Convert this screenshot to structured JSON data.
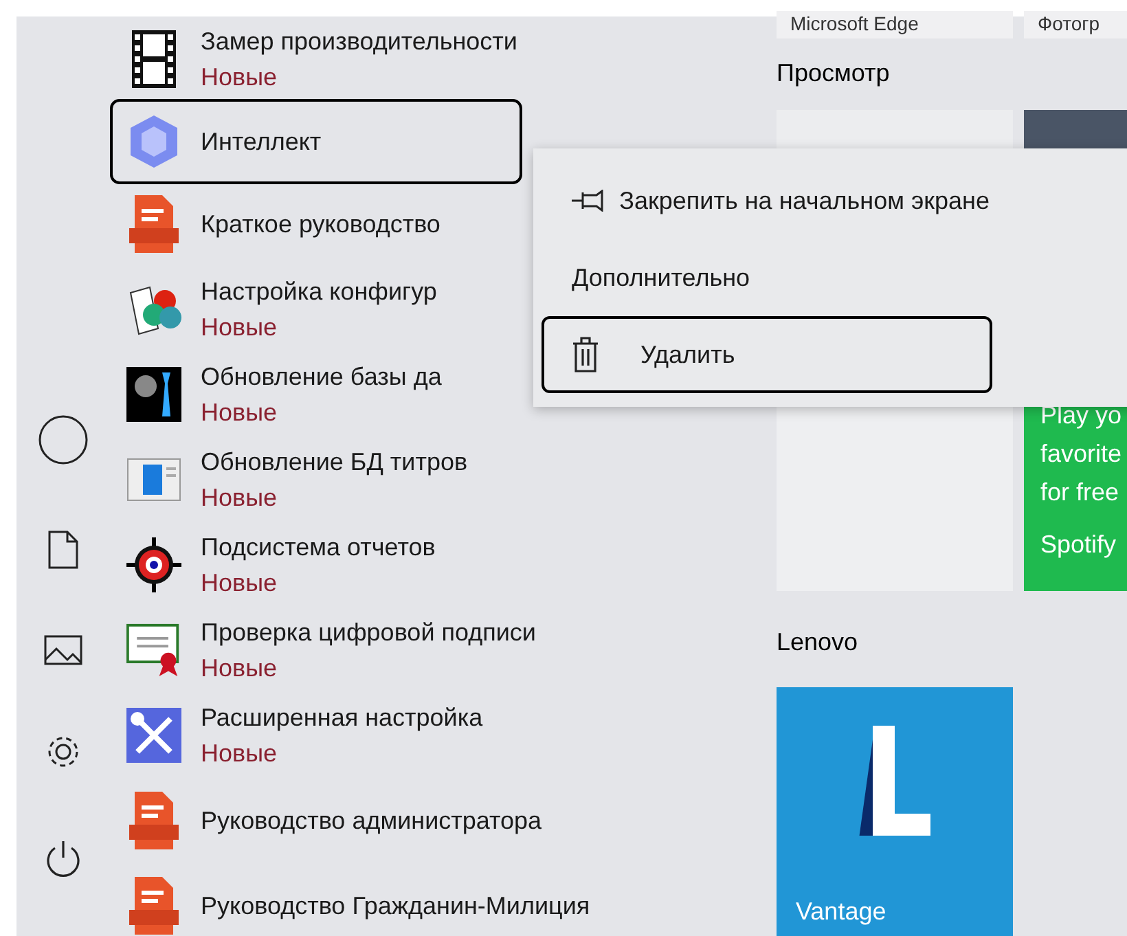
{
  "top_tiles": [
    {
      "label": "Microsoft Edge"
    },
    {
      "label": "Фотогр"
    }
  ],
  "apps": [
    {
      "name": "Замер производительности",
      "badge": "Новые",
      "selected": false
    },
    {
      "name": "Интеллект",
      "selected": true
    },
    {
      "name": "Краткое руководство",
      "selected": false
    },
    {
      "name": "Настройка конфигур",
      "badge": "Новые",
      "selected": false
    },
    {
      "name": "Обновление базы да",
      "badge": "Новые",
      "selected": false
    },
    {
      "name": "Обновление БД титров",
      "badge": "Новые",
      "selected": false
    },
    {
      "name": "Подсистема отчетов",
      "badge": "Новые",
      "selected": false
    },
    {
      "name": "Проверка цифровой подписи",
      "badge": "Новые",
      "selected": false
    },
    {
      "name": "Расширенная настройка",
      "badge": "Новые",
      "selected": false
    },
    {
      "name": "Руководство администратора",
      "selected": false
    },
    {
      "name": "Руководство Гражданин-Милиция",
      "selected": false
    }
  ],
  "groups": [
    {
      "title": "Просмотр"
    },
    {
      "title": "Lenovo"
    }
  ],
  "spotify_tile": {
    "lines": [
      "Play yo",
      "favorite",
      "for free"
    ],
    "label": "Spotify"
  },
  "vantage_tile": {
    "label": "Vantage"
  },
  "context_menu": [
    {
      "label": "Закрепить на начальном экране",
      "kind": "pin",
      "selected": false
    },
    {
      "label": "Дополнительно",
      "kind": "submenu",
      "selected": false
    },
    {
      "label": "Удалить",
      "kind": "delete",
      "selected": true
    }
  ]
}
